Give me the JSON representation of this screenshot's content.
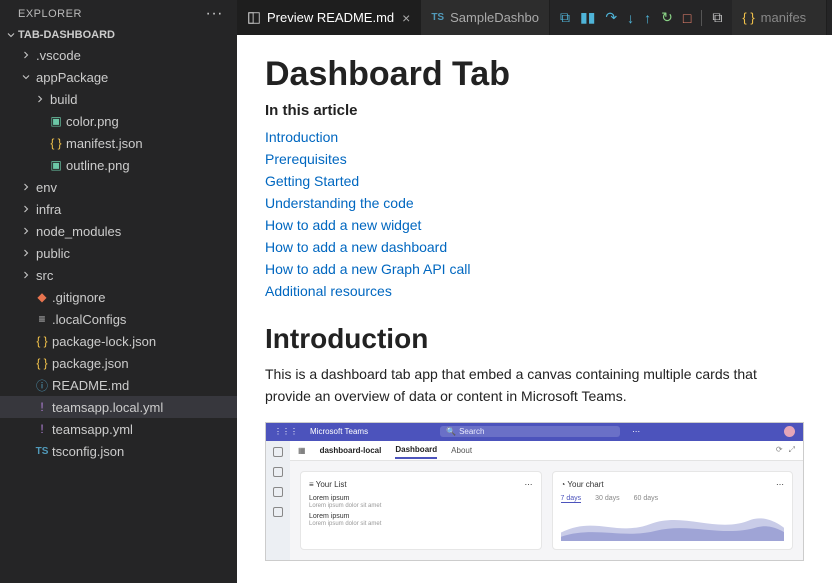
{
  "explorer": {
    "title": "EXPLORER"
  },
  "project": {
    "name": "TAB-DASHBOARD"
  },
  "tree": {
    "vscode": ".vscode",
    "appPackage": "appPackage",
    "build": "build",
    "colorpng": "color.png",
    "manifestjson": "manifest.json",
    "outlinepng": "outline.png",
    "env": "env",
    "infra": "infra",
    "node_modules": "node_modules",
    "public": "public",
    "src": "src",
    "gitignore": ".gitignore",
    "localConfigs": ".localConfigs",
    "packagelock": "package-lock.json",
    "packagejson": "package.json",
    "readme": "README.md",
    "teamsapplocal": "teamsapp.local.yml",
    "teamsappyml": "teamsapp.yml",
    "tsconfig": "tsconfig.json"
  },
  "tabs": {
    "preview": "Preview README.md",
    "sample": "SampleDashbo",
    "manifest": "manifes"
  },
  "tsprefix": "TS",
  "preview": {
    "h1": "Dashboard Tab",
    "inthis": "In this article",
    "toc": {
      "intro": "Introduction",
      "prereq": "Prerequisites",
      "getting": "Getting Started",
      "understand": "Understanding the code",
      "widget": "How to add a new widget",
      "dashboard": "How to add a new dashboard",
      "graph": "How to add a new Graph API call",
      "additional": "Additional resources"
    },
    "h2": "Introduction",
    "body": "This is a dashboard tab app that embed a canvas containing multiple cards that provide an overview of data or content in Microsoft Teams."
  },
  "teams": {
    "brand": "Microsoft Teams",
    "search": "Search",
    "app": "dashboard-local",
    "tabDash": "Dashboard",
    "tabAbout": "About",
    "card1": "Your List",
    "li": "Lorem ipsum",
    "lisub": "Lorem ipsum dolor sit amet",
    "card2": "Your chart",
    "d7": "7 days",
    "d30": "30 days",
    "d60": "60 days"
  }
}
